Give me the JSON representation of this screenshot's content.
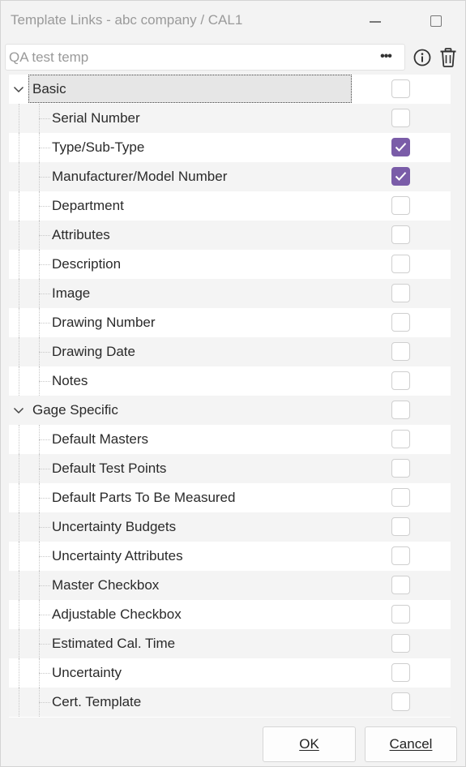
{
  "window": {
    "title": "Template Links - abc company / CAL1"
  },
  "search": {
    "value": "QA test temp",
    "ellipsis_label": "•••"
  },
  "toolbar": {
    "info_icon": "info-circle-icon",
    "delete_icon": "trash-icon"
  },
  "colors": {
    "accent": "#7a5ca8",
    "selection_bg": "#e6e6e6",
    "alt_row": "#f4f4f4"
  },
  "tree": {
    "groups": [
      {
        "label": "Basic",
        "checked": false,
        "expanded": true,
        "selected": true,
        "items": [
          {
            "label": "Serial Number",
            "checked": false
          },
          {
            "label": "Type/Sub-Type",
            "checked": true
          },
          {
            "label": "Manufacturer/Model Number",
            "checked": true
          },
          {
            "label": "Department",
            "checked": false
          },
          {
            "label": "Attributes",
            "checked": false
          },
          {
            "label": "Description",
            "checked": false
          },
          {
            "label": "Image",
            "checked": false
          },
          {
            "label": "Drawing Number",
            "checked": false
          },
          {
            "label": "Drawing Date",
            "checked": false
          },
          {
            "label": "Notes",
            "checked": false
          }
        ]
      },
      {
        "label": "Gage Specific",
        "checked": false,
        "expanded": true,
        "selected": false,
        "items": [
          {
            "label": "Default Masters",
            "checked": false
          },
          {
            "label": "Default Test Points",
            "checked": false
          },
          {
            "label": "Default Parts To Be Measured",
            "checked": false
          },
          {
            "label": "Uncertainty Budgets",
            "checked": false
          },
          {
            "label": "Uncertainty Attributes",
            "checked": false
          },
          {
            "label": "Master Checkbox",
            "checked": false
          },
          {
            "label": "Adjustable Checkbox",
            "checked": false
          },
          {
            "label": "Estimated Cal. Time",
            "checked": false
          },
          {
            "label": "Uncertainty",
            "checked": false
          },
          {
            "label": "Cert. Template",
            "checked": false
          }
        ]
      }
    ]
  },
  "footer": {
    "ok_label": "OK",
    "cancel_label": "Cancel"
  }
}
